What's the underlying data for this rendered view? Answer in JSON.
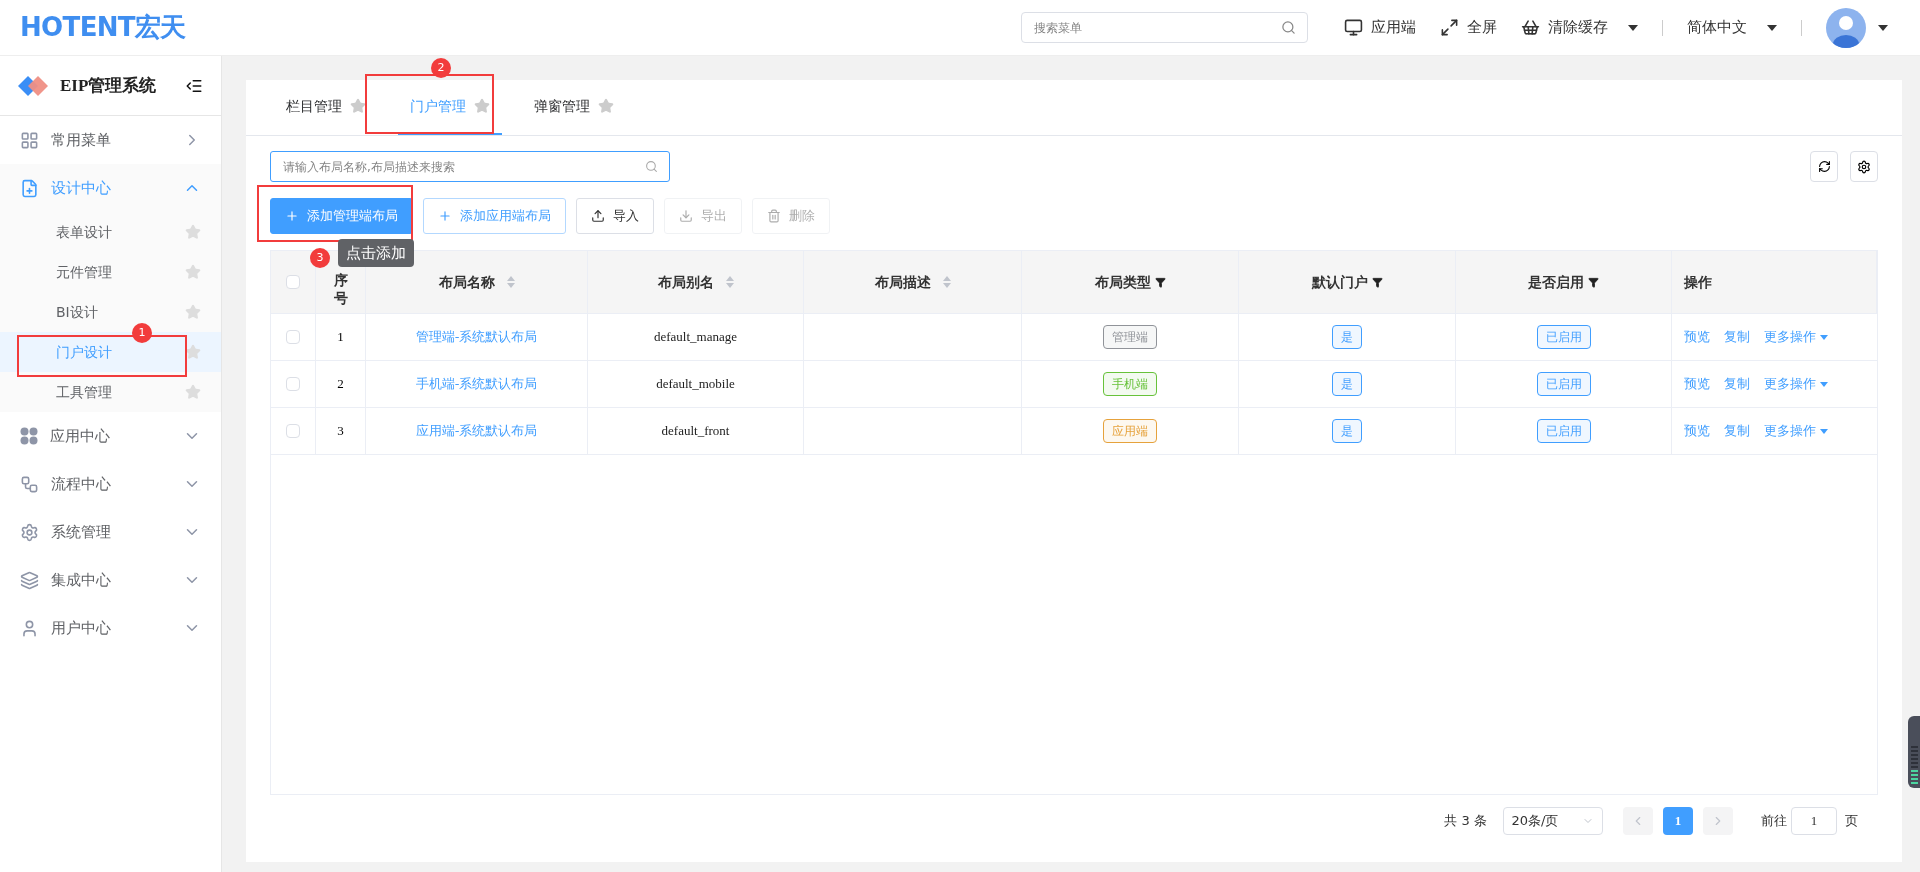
{
  "header": {
    "logo": "HOTENT宏天",
    "search": {
      "placeholder": "搜索菜单"
    },
    "actions": [
      {
        "label": "应用端",
        "caret": false
      },
      {
        "label": "全屏",
        "caret": false
      },
      {
        "label": "清除缓存",
        "caret": true
      }
    ],
    "language": "简体中文"
  },
  "sidebar": {
    "title": "EIP管理系统",
    "items": [
      {
        "label": "常用菜单",
        "expanded": false,
        "kind": "flyout"
      },
      {
        "label": "设计中心",
        "expanded": true,
        "kind": "group",
        "children": [
          {
            "label": "表单设计",
            "selected": false
          },
          {
            "label": "元件管理",
            "selected": false
          },
          {
            "label": "BI设计",
            "selected": false
          },
          {
            "label": "门户设计",
            "selected": true
          },
          {
            "label": "工具管理",
            "selected": false
          }
        ]
      },
      {
        "label": "应用中心",
        "expanded": false,
        "kind": "group"
      },
      {
        "label": "流程中心",
        "expanded": false,
        "kind": "group"
      },
      {
        "label": "系统管理",
        "expanded": false,
        "kind": "group"
      },
      {
        "label": "集成中心",
        "expanded": false,
        "kind": "group"
      },
      {
        "label": "用户中心",
        "expanded": false,
        "kind": "group"
      }
    ]
  },
  "tabs": [
    {
      "label": "栏目管理",
      "selected": false
    },
    {
      "label": "门户管理",
      "selected": true
    },
    {
      "label": "弹窗管理",
      "selected": false
    }
  ],
  "search": {
    "placeholder": "请输入布局名称,布局描述来搜索"
  },
  "buttons": [
    {
      "label": "添加管理端布局",
      "kind": "primary",
      "disabled": false
    },
    {
      "label": "添加应用端布局",
      "kind": "plain-blue",
      "disabled": false
    },
    {
      "label": "导入",
      "kind": "import",
      "disabled": false
    },
    {
      "label": "导出",
      "kind": "export",
      "disabled": true
    },
    {
      "label": "删除",
      "kind": "delete",
      "disabled": true
    }
  ],
  "table": {
    "columns": [
      {
        "label": "序号",
        "kind": "plain"
      },
      {
        "label": "布局名称",
        "kind": "sort"
      },
      {
        "label": "布局别名",
        "kind": "sort"
      },
      {
        "label": "布局描述",
        "kind": "sort"
      },
      {
        "label": "布局类型",
        "kind": "filter"
      },
      {
        "label": "默认门户",
        "kind": "filter"
      },
      {
        "label": "是否启用",
        "kind": "filter"
      },
      {
        "label": "操作",
        "kind": "plain"
      }
    ],
    "header_checkbox": {
      "checked": false
    },
    "rows": [
      {
        "checked": false,
        "index": "1",
        "name": "管理端-系统默认布局",
        "alias": "default_manage",
        "type": {
          "text": "管理端",
          "color": "#909399"
        },
        "default": "是",
        "enabled": "已启用",
        "actions": [
          "预览",
          "复制",
          "更多操作"
        ]
      },
      {
        "checked": false,
        "index": "2",
        "name": "手机端-系统默认布局",
        "alias": "default_mobile",
        "type": {
          "text": "手机端",
          "color": "#67c23a"
        },
        "default": "是",
        "enabled": "已启用",
        "actions": [
          "预览",
          "复制",
          "更多操作"
        ]
      },
      {
        "checked": false,
        "index": "3",
        "name": "应用端-系统默认布局",
        "alias": "default_front",
        "type": {
          "text": "应用端",
          "color": "#e6a23c"
        },
        "default": "是",
        "enabled": "已启用",
        "actions": [
          "预览",
          "复制",
          "更多操作"
        ]
      }
    ]
  },
  "pagination": {
    "total": "共 3 条",
    "page_size": "20条/页",
    "pages": [
      {
        "label": "1",
        "selected": true
      }
    ],
    "goto": "前往",
    "goto_value": "1",
    "suffix": "页"
  },
  "annotations": [
    {
      "number": "1"
    },
    {
      "number": "2"
    },
    {
      "number": "3",
      "tooltip": "点击添加"
    }
  ]
}
